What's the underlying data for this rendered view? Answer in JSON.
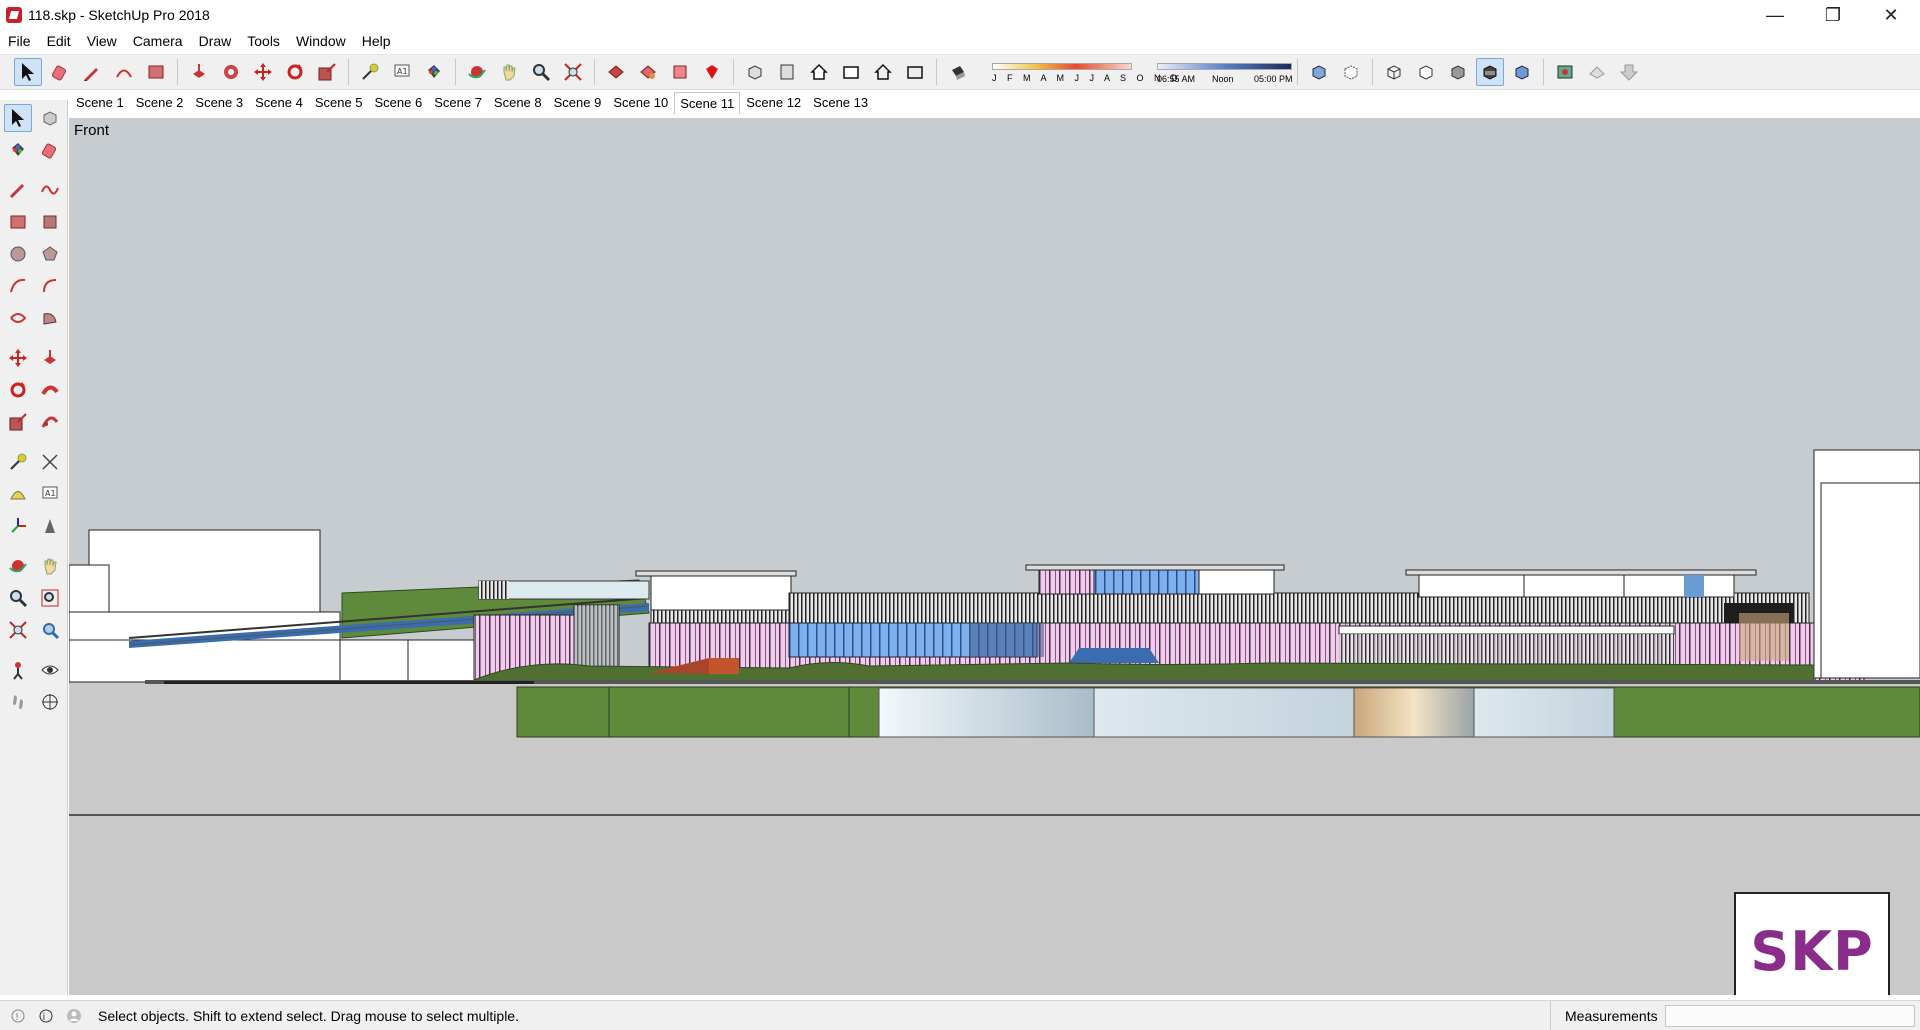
{
  "window": {
    "title": "118.skp - SketchUp Pro 2018",
    "controls": {
      "minimize": "—",
      "restore": "❐",
      "close": "✕"
    }
  },
  "menu": [
    "File",
    "Edit",
    "View",
    "Camera",
    "Draw",
    "Tools",
    "Window",
    "Help"
  ],
  "toolbar": {
    "shadow_months": "J F M A M J J A S O N D",
    "shadow_time_start": "06:55 AM",
    "shadow_time_mid": "Noon",
    "shadow_time_end": "05:00 PM",
    "icons": [
      "select-icon",
      "eraser-icon",
      "pencil-icon",
      "paint-bucket-icon",
      "push-pull-icon",
      "move-icon",
      "rotate-icon",
      "scale-icon",
      "tape-measure-icon",
      "text-icon",
      "orbit-icon",
      "pan-icon",
      "zoom-icon",
      "zoom-extents-icon",
      "warehouse-icon",
      "extension-warehouse-icon",
      "ruby-icon",
      "iso-view-icon",
      "top-view-icon",
      "front-view-icon",
      "right-view-icon",
      "back-view-icon",
      "left-view-icon",
      "xray-icon",
      "wireframe-icon",
      "hidden-line-icon",
      "shaded-icon",
      "shaded-textures-icon",
      "monochrome-icon",
      "section-plane-icon",
      "section-cuts-icon",
      "section-display-icon"
    ]
  },
  "scenes": {
    "tabs": [
      "Scene 1",
      "Scene 2",
      "Scene 3",
      "Scene 4",
      "Scene 5",
      "Scene 6",
      "Scene 7",
      "Scene 8",
      "Scene 9",
      "Scene 10",
      "Scene 11",
      "Scene 12",
      "Scene 13"
    ],
    "active": "Scene 11"
  },
  "viewport": {
    "view_name": "Front",
    "logo_text": "SKP",
    "sky_color": "#c7ccd0",
    "ground_color": "#c9c9c9",
    "accent_pink": "#f5c2f0",
    "accent_blue": "#6aa0e8",
    "grass_green": "#5f8a3c"
  },
  "status": {
    "hint": "Select objects. Shift to extend select. Drag mouse to select multiple.",
    "measurements_label": "Measurements",
    "measurements_value": ""
  }
}
